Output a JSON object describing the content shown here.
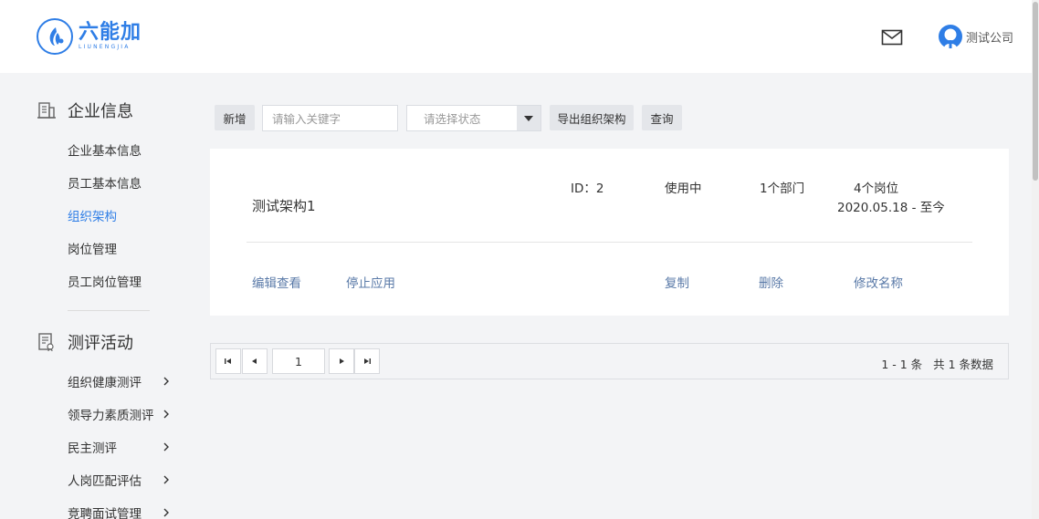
{
  "header": {
    "logo_cn": "六能加",
    "logo_en": "LIUNENGJIA",
    "user_name": "测试公司"
  },
  "sidebar": {
    "section1": {
      "title": "企业信息",
      "items": [
        {
          "label": "企业基本信息"
        },
        {
          "label": "员工基本信息"
        },
        {
          "label": "组织架构",
          "active": true
        },
        {
          "label": "岗位管理"
        },
        {
          "label": "员工岗位管理"
        }
      ]
    },
    "section2": {
      "title": "测评活动",
      "items": [
        {
          "label": "组织健康测评"
        },
        {
          "label": "领导力素质测评"
        },
        {
          "label": "民主测评"
        },
        {
          "label": "人岗匹配评估"
        },
        {
          "label": "竞聘面试管理"
        }
      ]
    }
  },
  "toolbar": {
    "add_label": "新增",
    "keyword_placeholder": "请输入关键字",
    "status_placeholder": "请选择状态",
    "export_label": "导出组织架构",
    "query_label": "查询"
  },
  "card": {
    "name": "测试架构1",
    "id_text": "ID：2",
    "status": "使用中",
    "departments": "1个部门",
    "positions": "4个岗位",
    "period": "2020.05.18 - 至今",
    "actions": {
      "edit_view": "编辑查看",
      "stop": "停止应用",
      "copy": "复制",
      "delete": "删除",
      "rename": "修改名称"
    }
  },
  "pager": {
    "current_page": "1",
    "range": "1 - 1 条",
    "total": "共 1 条数据"
  },
  "colors": {
    "accent": "#2f7ee6",
    "link": "#5a7aa8",
    "background": "#f3f4f6"
  },
  "icons": [
    "logo-mark",
    "mail-icon",
    "user-avatar-icon",
    "building-icon",
    "clipboard-icon",
    "chevron-right-icon",
    "first-page-icon",
    "prev-page-icon",
    "next-page-icon",
    "last-page-icon",
    "caret-down-icon"
  ]
}
